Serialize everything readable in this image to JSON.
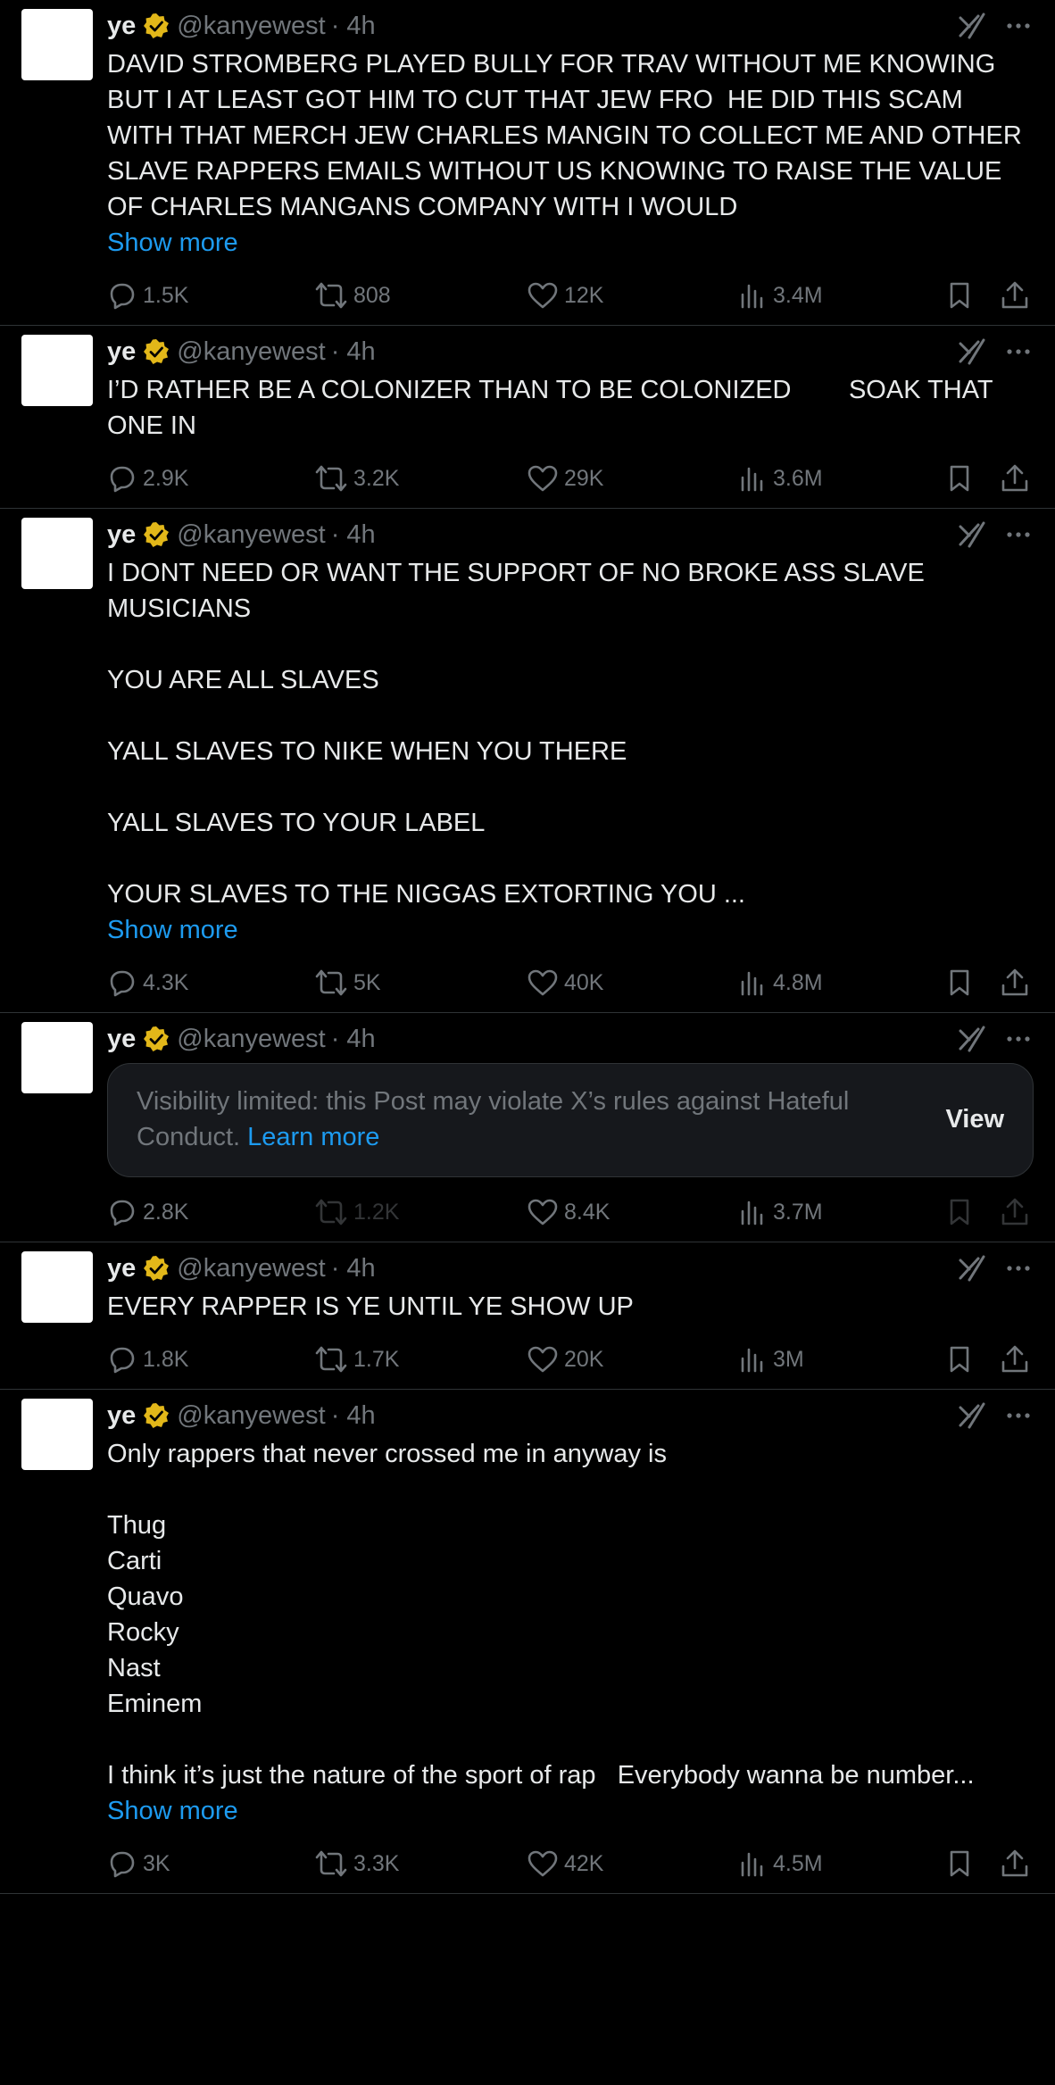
{
  "colors": {
    "background": "#000000",
    "text": "#e7e9ea",
    "muted": "#71767b",
    "link": "#1d9bf0",
    "verified": "#e2b719"
  },
  "tweets": [
    {
      "name": "ye",
      "handle": "@kanyewest",
      "time": "· 4h",
      "text": "DAVID STROMBERG PLAYED BULLY FOR TRAV WITHOUT ME KNOWING BUT I AT LEAST GOT HIM TO CUT THAT JEW FRO  HE DID THIS SCAM WITH THAT MERCH JEW CHARLES MANGIN TO COLLECT ME AND OTHER SLAVE RAPPERS EMAILS WITHOUT US KNOWING TO RAISE THE VALUE OF CHARLES MANGANS COMPANY WITH I WOULD",
      "show_more": "Show more",
      "replies": "1.5K",
      "reposts": "808",
      "likes": "12K",
      "views": "3.4M"
    },
    {
      "name": "ye",
      "handle": "@kanyewest",
      "time": "· 4h",
      "text": "I’D RATHER BE A COLONIZER THAN TO BE COLONIZED        SOAK THAT ONE IN",
      "replies": "2.9K",
      "reposts": "3.2K",
      "likes": "29K",
      "views": "3.6M"
    },
    {
      "name": "ye",
      "handle": "@kanyewest",
      "time": "· 4h",
      "text": "I DONT NEED OR WANT THE SUPPORT OF NO BROKE ASS SLAVE MUSICIANS\n\nYOU ARE ALL SLAVES\n\nYALL SLAVES TO NIKE WHEN YOU THERE\n\nYALL SLAVES TO YOUR LABEL\n\nYOUR SLAVES TO THE NIGGAS EXTORTING YOU ...",
      "show_more": "Show more",
      "replies": "4.3K",
      "reposts": "5K",
      "likes": "40K",
      "views": "4.8M"
    },
    {
      "name": "ye",
      "handle": "@kanyewest",
      "time": "· 4h",
      "notice": "Visibility limited: this Post may violate X’s rules against Hateful Conduct.",
      "notice_link": "Learn more",
      "notice_button": "View",
      "replies": "2.8K",
      "reposts": "1.2K",
      "likes": "8.4K",
      "views": "3.7M"
    },
    {
      "name": "ye",
      "handle": "@kanyewest",
      "time": "· 4h",
      "text": "EVERY RAPPER IS YE UNTIL YE SHOW UP",
      "replies": "1.8K",
      "reposts": "1.7K",
      "likes": "20K",
      "views": "3M"
    },
    {
      "name": "ye",
      "handle": "@kanyewest",
      "time": "· 4h",
      "text": "Only rappers that never crossed me in anyway is\n\nThug\nCarti\nQuavo\nRocky\nNast\nEminem\n\nI think it’s just the nature of the sport of rap   Everybody wanna be number...",
      "show_more": "Show more",
      "replies": "3K",
      "reposts": "3.3K",
      "likes": "42K",
      "views": "4.5M"
    }
  ]
}
